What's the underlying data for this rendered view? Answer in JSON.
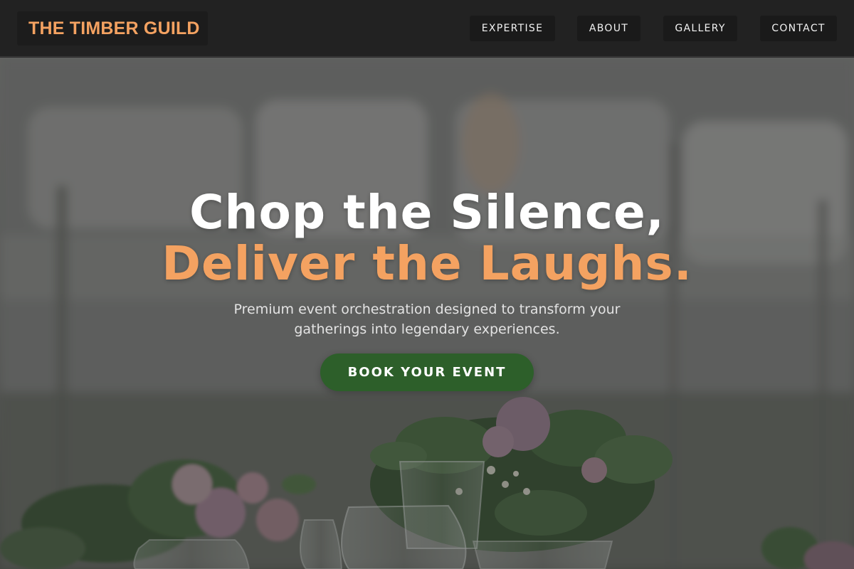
{
  "brand": {
    "name": "THE TIMBER GUILD"
  },
  "nav": {
    "items": [
      {
        "label": "EXPERTISE"
      },
      {
        "label": "ABOUT"
      },
      {
        "label": "GALLERY"
      },
      {
        "label": "CONTACT"
      }
    ]
  },
  "hero": {
    "headline_line1": "Chop the Silence,",
    "headline_line2": "Deliver the Laughs.",
    "subtitle": "Premium event orchestration designed to transform your gatherings into legendary experiences.",
    "cta_label": "BOOK YOUR EVENT"
  },
  "colors": {
    "accent": "#f4a261",
    "cta_green": "#2d5f2a",
    "header_bg": "#222222"
  }
}
